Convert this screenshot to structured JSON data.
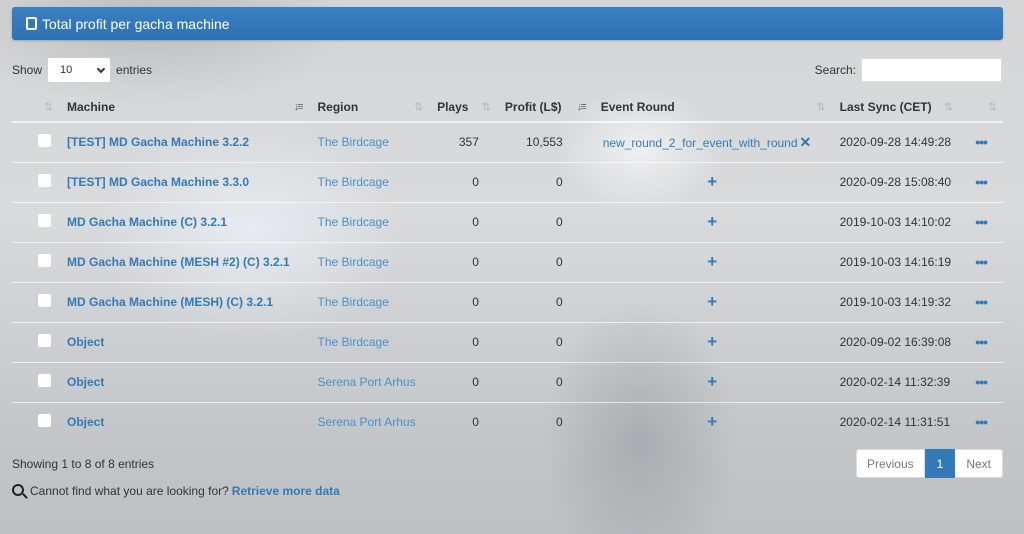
{
  "panel": {
    "title": "Total profit per gacha machine",
    "icon": "tablet-icon"
  },
  "length_control": {
    "prefix": "Show",
    "selected": "10",
    "suffix": "entries"
  },
  "search": {
    "label": "Search:",
    "value": "",
    "placeholder": ""
  },
  "table": {
    "columns": [
      {
        "key": "select",
        "label": ""
      },
      {
        "key": "machine",
        "label": "Machine",
        "sort": "ascending"
      },
      {
        "key": "region",
        "label": "Region"
      },
      {
        "key": "plays",
        "label": "Plays"
      },
      {
        "key": "profit",
        "label": "Profit (L$)",
        "sort": "descending"
      },
      {
        "key": "event_round",
        "label": "Event Round"
      },
      {
        "key": "last_sync",
        "label": "Last Sync (CET)"
      },
      {
        "key": "actions",
        "label": ""
      }
    ],
    "rows": [
      {
        "machine": "[TEST] MD Gacha Machine 3.2.2",
        "region": "The Birdcage",
        "plays": "357",
        "profit": "10,553",
        "event_round": "new_round_2_for_event_with_round",
        "last_sync": "2020-09-28 14:49:28"
      },
      {
        "machine": "[TEST] MD Gacha Machine 3.3.0",
        "region": "The Birdcage",
        "plays": "0",
        "profit": "0",
        "event_round": "",
        "last_sync": "2020-09-28 15:08:40"
      },
      {
        "machine": "MD Gacha Machine (C) 3.2.1",
        "region": "The Birdcage",
        "plays": "0",
        "profit": "0",
        "event_round": "",
        "last_sync": "2019-10-03 14:10:02"
      },
      {
        "machine": "MD Gacha Machine (MESH #2) (C) 3.2.1",
        "region": "The Birdcage",
        "plays": "0",
        "profit": "0",
        "event_round": "",
        "last_sync": "2019-10-03 14:16:19"
      },
      {
        "machine": "MD Gacha Machine (MESH) (C) 3.2.1",
        "region": "The Birdcage",
        "plays": "0",
        "profit": "0",
        "event_round": "",
        "last_sync": "2019-10-03 14:19:32"
      },
      {
        "machine": "Object",
        "region": "The Birdcage",
        "plays": "0",
        "profit": "0",
        "event_round": "",
        "last_sync": "2020-09-02 16:39:08"
      },
      {
        "machine": "Object",
        "region": "Serena Port Arhus",
        "plays": "0",
        "profit": "0",
        "event_round": "",
        "last_sync": "2020-02-14 11:32:39"
      },
      {
        "machine": "Object",
        "region": "Serena Port Arhus",
        "plays": "0",
        "profit": "0",
        "event_round": "",
        "last_sync": "2020-02-14 11:31:51"
      }
    ]
  },
  "icons": {
    "remove": "✕",
    "add": "+",
    "more": "•••",
    "sort_both": "⇅",
    "sort_asc": "↓≡",
    "sort_desc": "↓≡"
  },
  "footer": {
    "info": "Showing 1 to 8 of 8 entries",
    "help_text": "Cannot find what you are looking for?",
    "help_link": "Retrieve more data"
  },
  "pagination": {
    "previous": "Previous",
    "current": "1",
    "next": "Next"
  },
  "colors": {
    "primary": "#337ab7",
    "header": "#2f72b3"
  }
}
